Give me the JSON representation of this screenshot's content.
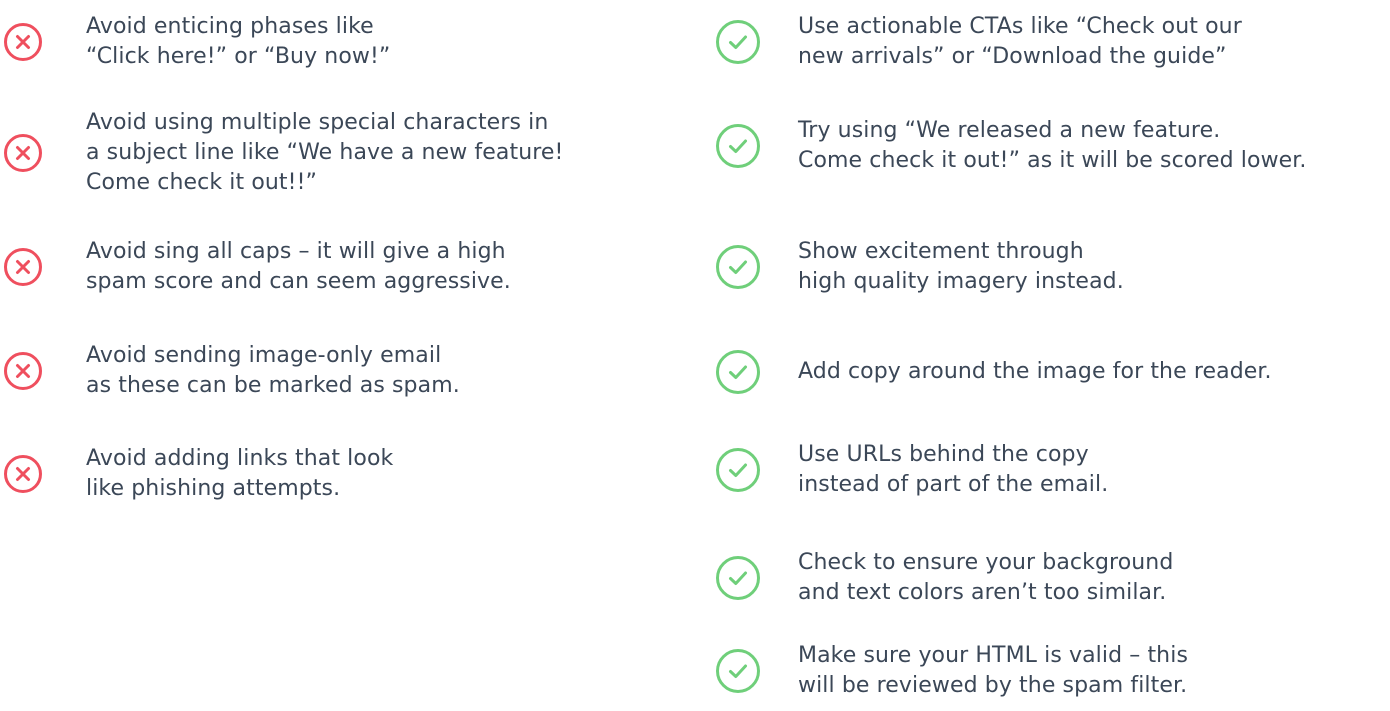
{
  "colors": {
    "dont_icon": "#ef4f5e",
    "do_icon": "#6fcf7a",
    "text": "#3b4757",
    "background": "#ffffff"
  },
  "donts": {
    "icon": "x-circle-icon",
    "items": [
      {
        "text": "Avoid enticing phases like\n“Click here!” or “Buy now!”"
      },
      {
        "text": "Avoid using multiple special characters in\na subject line like “We have a new feature!\nCome check it out!!”"
      },
      {
        "text": "Avoid sing all caps – it will give a high\nspam score and can seem aggressive."
      },
      {
        "text": "Avoid sending image-only email\nas these can be marked as spam."
      },
      {
        "text": "Avoid adding links that look\nlike phishing attempts."
      }
    ]
  },
  "dos": {
    "icon": "check-circle-icon",
    "items": [
      {
        "text": "Use actionable CTAs like “Check out our\nnew arrivals” or “Download the guide”"
      },
      {
        "text": "Try using “We released a new feature.\nCome check it out!” as it will be scored lower."
      },
      {
        "text": "Show excitement through\nhigh quality imagery instead."
      },
      {
        "text": "Add copy around the image for the reader."
      },
      {
        "text": "Use URLs behind the copy\ninstead of part of the email."
      },
      {
        "text": "Check to ensure your background\nand text colors aren’t too similar."
      },
      {
        "text": "Make sure your HTML is valid – this\nwill be reviewed by the spam filter."
      }
    ]
  }
}
